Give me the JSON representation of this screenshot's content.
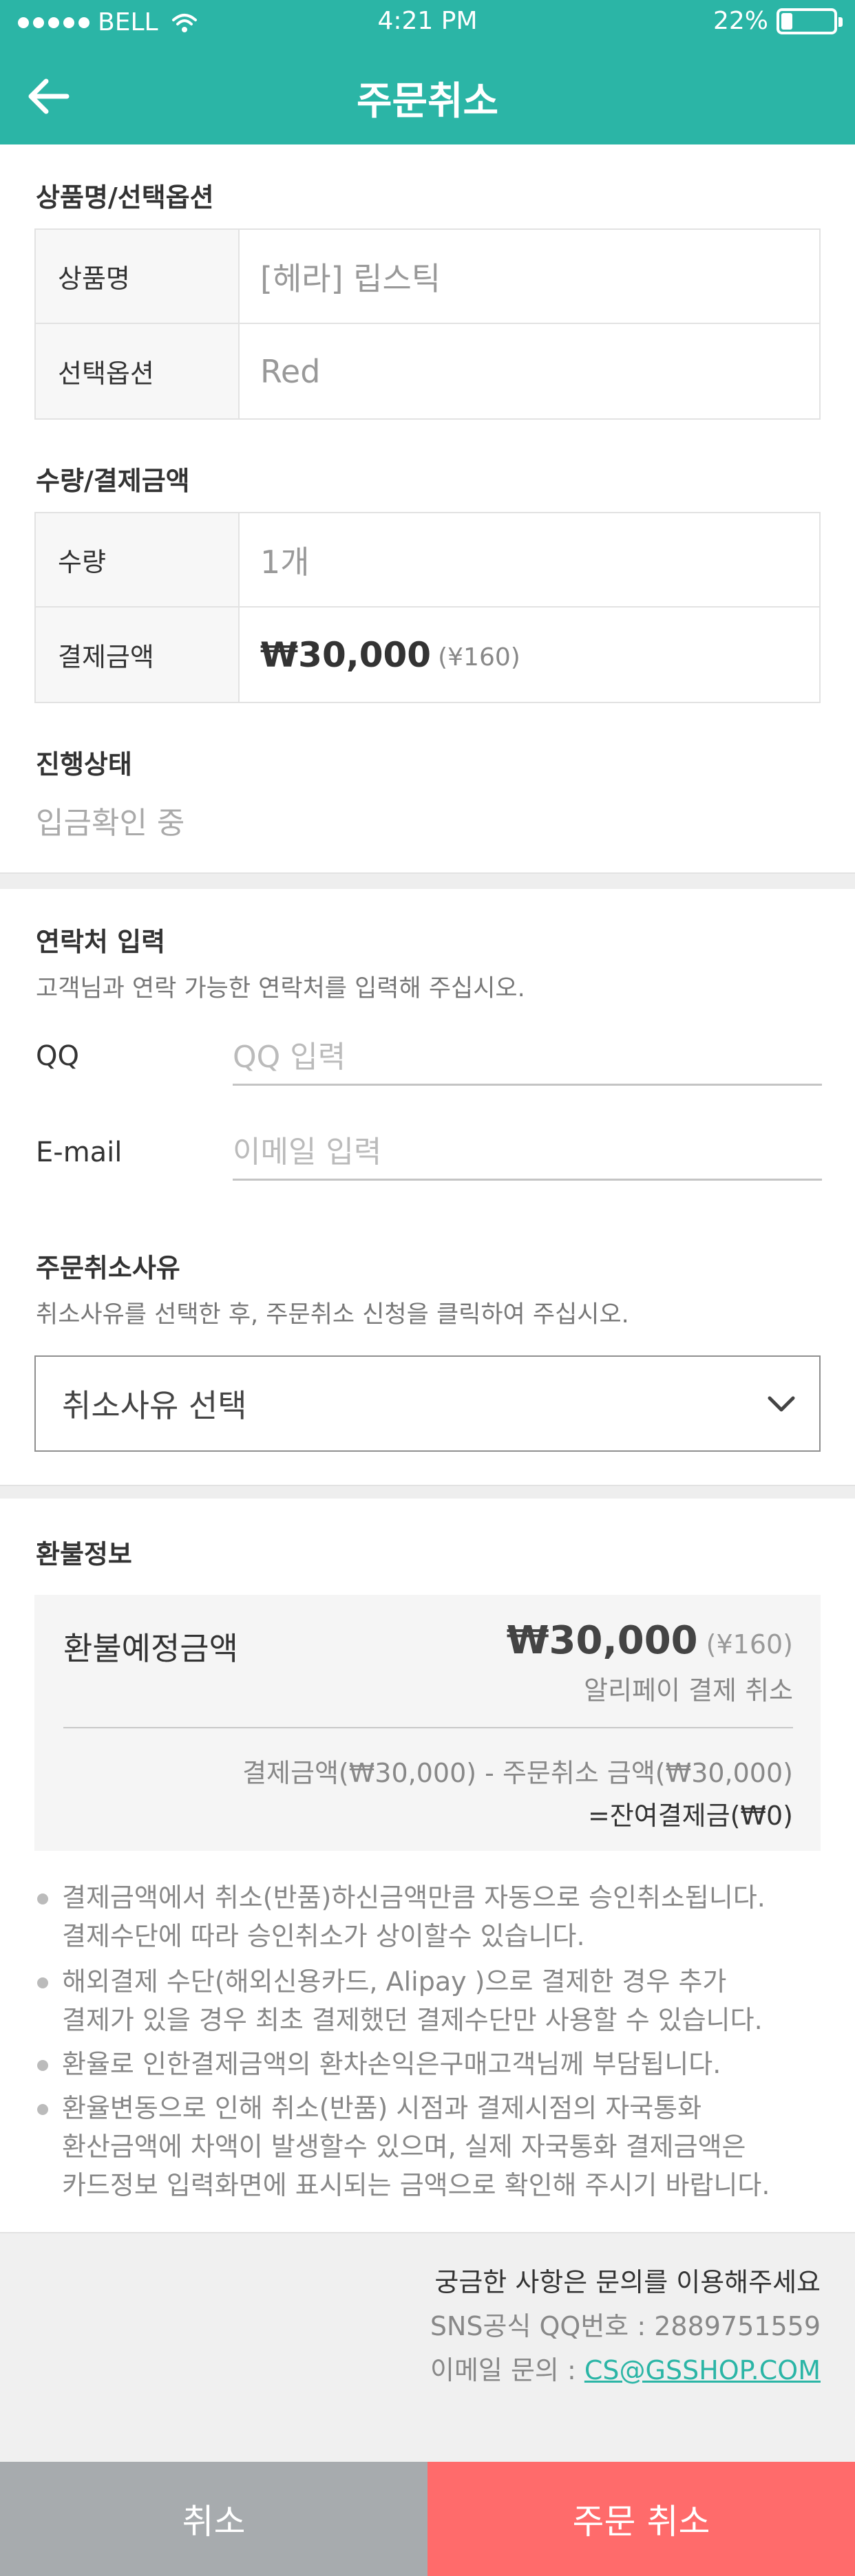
{
  "status_bar": {
    "carrier": "BELL",
    "time": "4:21 PM",
    "battery_text": "22%",
    "battery_level": 0.22
  },
  "nav": {
    "title": "주문취소",
    "back_icon": "arrow-left-icon"
  },
  "product": {
    "section_title": "상품명/선택옵션",
    "rows": [
      {
        "label": "상품명",
        "value": "[헤라] 립스틱"
      },
      {
        "label": "선택옵션",
        "value": "Red"
      }
    ]
  },
  "payment": {
    "section_title": "수량/결제금액",
    "quantity_label": "수량",
    "quantity_value": "1개",
    "amount_label": "결제금액",
    "amount_value": "₩30,000",
    "amount_sub": "(¥160)"
  },
  "progress": {
    "section_title": "진행상태",
    "value": "입금확인 중"
  },
  "contact": {
    "section_title": "연락처 입력",
    "subtitle": "고객님과 연락 가능한 연락처를 입력해 주십시오.",
    "qq_label": "QQ",
    "qq_placeholder": "QQ 입력",
    "email_label": "E-mail",
    "email_placeholder": "이메일 입력"
  },
  "reason": {
    "section_title": "주문취소사유",
    "subtitle": "취소사유를 선택한 후, 주문취소 신청을 클릭하여 주십시오.",
    "select_value": "취소사유 선택",
    "chevron_icon": "chevron-down-icon"
  },
  "refund": {
    "section_title": "환불정보",
    "label": "환불예정금액",
    "amount": "₩30,000",
    "amount_sub": "(¥160)",
    "method": "알리페이 결제 취소",
    "calc": "결제금액(₩30,000) - 주문취소 금액(₩30,000)",
    "balance": "=잔여결제금(₩0)"
  },
  "notes": [
    {
      "lines": [
        "결제금액에서 취소(반품)하신금액만큼 자동으로 승인취소됩니다.",
        "결제수단에 따라 승인취소가 상이할수 있습니다."
      ]
    },
    {
      "lines": [
        "해외결제 수단(해외신용카드, Alipay )으로 결제한 경우 추가",
        "결제가 있을 경우 최초 결제했던 결제수단만 사용할 수 있습니다."
      ]
    },
    {
      "lines": [
        "환율로 인한결제금액의 환차손익은구매고객님께 부담됩니다."
      ]
    },
    {
      "lines": [
        "환율변동으로 인해 취소(반품) 시점과 결제시점의 자국통화",
        "환산금액에 차액이 발생할수 있으며, 실제 자국통화 결제금액은",
        "카드정보 입력화면에 표시되는 금액으로 확인해 주시기 바랍니다."
      ]
    }
  ],
  "footer": {
    "title": "궁금한 사항은 문의를 이용해주세요",
    "qq_text": "SNS공식 QQ번호 : 2889751559",
    "email_prefix": "이메일 문의 : ",
    "email_link": "CS@GSSHOP.COM"
  },
  "buttons": {
    "cancel": "취소",
    "order_cancel": "주문 취소"
  }
}
